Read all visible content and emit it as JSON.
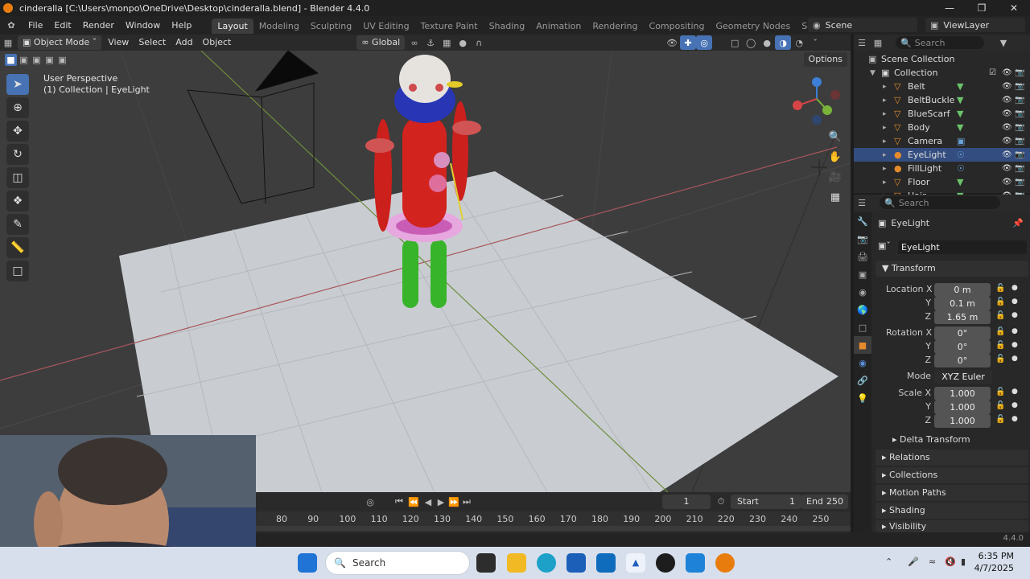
{
  "window": {
    "title": "cinderalla [C:\\Users\\monpo\\OneDrive\\Desktop\\cinderalla.blend] - Blender 4.4.0"
  },
  "menu": [
    "File",
    "Edit",
    "Render",
    "Window",
    "Help"
  ],
  "workspaces": [
    "Layout",
    "Modeling",
    "Sculpting",
    "UV Editing",
    "Texture Paint",
    "Shading",
    "Animation",
    "Rendering",
    "Compositing",
    "Geometry Nodes",
    "Scripting"
  ],
  "active_workspace": "Layout",
  "scene": {
    "label": "Scene"
  },
  "view_layer": {
    "label": "ViewLayer"
  },
  "viewport_header": {
    "mode": "Object Mode",
    "menus": [
      "View",
      "Select",
      "Add",
      "Object"
    ],
    "transform_orientation": "Global",
    "options": "Options"
  },
  "viewport": {
    "perspective": "User Perspective",
    "context": "(1) Collection | EyeLight"
  },
  "outliner": {
    "search_placeholder": "Search",
    "scene_collection": "Scene Collection",
    "collection": "Collection",
    "items": [
      {
        "name": "Belt",
        "type": "mesh"
      },
      {
        "name": "BeltBuckle",
        "type": "mesh"
      },
      {
        "name": "BlueScarf",
        "type": "mesh"
      },
      {
        "name": "Body",
        "type": "mesh"
      },
      {
        "name": "Camera",
        "type": "camera"
      },
      {
        "name": "EyeLight",
        "type": "light",
        "selected": true
      },
      {
        "name": "FillLight",
        "type": "light"
      },
      {
        "name": "Floor",
        "type": "mesh"
      },
      {
        "name": "Hair",
        "type": "mesh"
      }
    ]
  },
  "properties": {
    "search_placeholder": "Search",
    "object_name": "EyeLight",
    "data_name": "EyeLight",
    "transform_label": "Transform",
    "location": {
      "label": "Location X",
      "x": "0 m",
      "y": "0.1 m",
      "z": "1.65 m"
    },
    "rotation": {
      "label": "Rotation X",
      "x": "0°",
      "y": "0°",
      "z": "0°"
    },
    "axis_y": "Y",
    "axis_z": "Z",
    "mode_label": "Mode",
    "mode_value": "XYZ Euler",
    "scale": {
      "label": "Scale X",
      "x": "1.000",
      "y": "1.000",
      "z": "1.000"
    },
    "panels": [
      "Delta Transform",
      "Relations",
      "Collections",
      "Motion Paths",
      "Shading",
      "Visibility"
    ]
  },
  "timeline": {
    "current_frame": "1",
    "start_label": "Start",
    "start": "1",
    "end_label": "End",
    "end": "250",
    "ticks": [
      "80",
      "90",
      "100",
      "110",
      "120",
      "130",
      "140",
      "150",
      "160",
      "170",
      "180",
      "190",
      "200",
      "210",
      "220",
      "230",
      "240",
      "250"
    ]
  },
  "status": {
    "version": "4.4.0"
  },
  "taskbar": {
    "search_placeholder": "Search",
    "time": "6:35 PM",
    "date": "4/7/2025"
  },
  "colors": {
    "accent": "#4772b3",
    "selected_row": "#334d80",
    "viewport_bg": "#3d3d3d",
    "floor": "#c7cbd0"
  }
}
